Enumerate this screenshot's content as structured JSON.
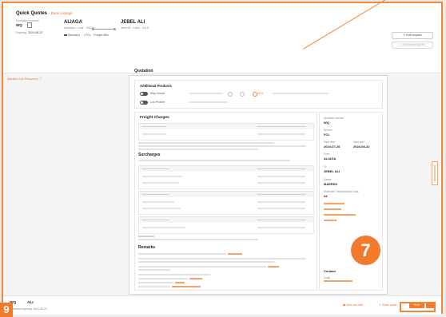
{
  "header": {
    "title": "Quick Quotes",
    "back_link": "Back Listings",
    "quotation_number_label": "Quotation number",
    "quotation_number": "WQ",
    "expiry_label": "Expiring",
    "expiry_date": "2024-08-22",
    "origin": {
      "code": "ALIAGA",
      "sub": "Ardbaturu · İzmir · Türkiye"
    },
    "destination": {
      "code": "JEBEL ALI",
      "sub": "Jebel Ali · Dubai · U.A.E."
    },
    "mode_chip": "Standard",
    "container_chip": "FCL · Freight Allin",
    "edit_button": "Edit request",
    "second_button": "Download Quote",
    "details_link": "Market Link Recovery"
  },
  "document": {
    "title": "Quotation",
    "additional_products": {
      "title": "Additional Products",
      "toggle1_label": "Ship Insure",
      "toggle2_label": "Lox Protect",
      "selected_value": "30%"
    },
    "freight_charges": {
      "title": "Freight Charges",
      "surcharges_title": "Surcharges",
      "remarks_title": "Remarks"
    },
    "sidebar": {
      "quotation_number_label": "Quotation number",
      "quotation_number": "WQ",
      "service_label": "Service",
      "service_value": "FCL",
      "valid_from_label": "Valid from",
      "valid_from": "2024-07-26",
      "valid_until_label": "Valid until",
      "valid_until": "2024-08-22",
      "from_label": "From",
      "from_value": "ALIAGA",
      "to_label": "To",
      "to_value": "JEBEL ALI",
      "carrier_label": "Carrier",
      "carrier_value": "MAERSK",
      "transit_label": "Estimated Transportation Days",
      "transit_value": "44",
      "contact_title": "Contact",
      "contact_label": "Email"
    }
  },
  "footer": {
    "origin": "WQ",
    "destination": "ALI",
    "expiry": "Quotation expiring: 2024-08-22",
    "link1": "Save as Draft",
    "link2": "Share quote",
    "book_label": "Book"
  },
  "overlay": {
    "step_badge": "7",
    "corner_number": "9"
  },
  "colors": {
    "accent": "#f27a2c",
    "border_highlight": "#f0883a"
  }
}
